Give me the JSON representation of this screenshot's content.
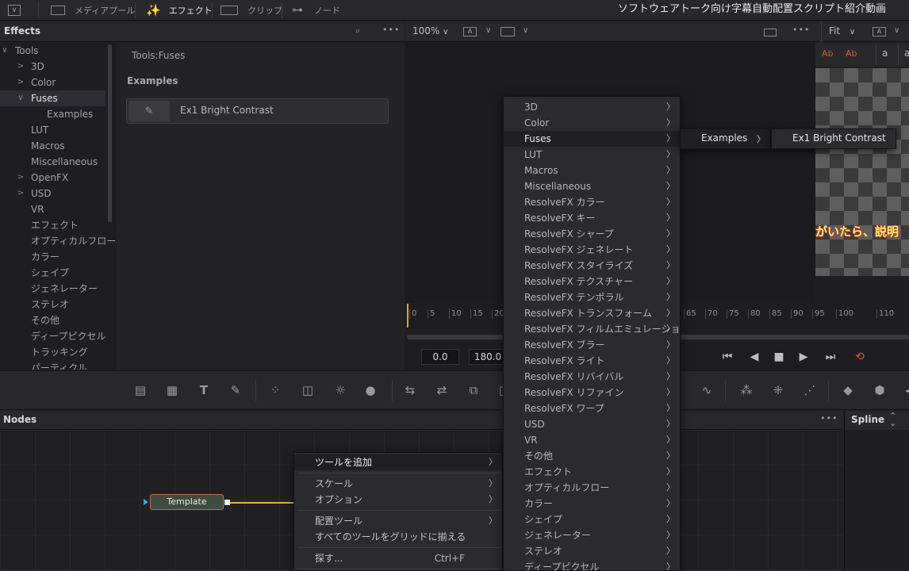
{
  "topbar": {
    "media_pool": "メディアプール",
    "effects": "エフェクト",
    "clips": "クリップ",
    "nodes": "ノード",
    "app_title": "ソフトウェアトーク向け字幕自動配置スクリプト紹介動画"
  },
  "effects_panel": {
    "title": "Effects",
    "breadcrumb": "Tools:Fuses",
    "section_heading": "Examples",
    "item_label": "Ex1 Bright Contrast",
    "tree": [
      {
        "label": "Tools",
        "chev": "∨"
      },
      {
        "label": "3D",
        "chev": ">"
      },
      {
        "label": "Color",
        "chev": ">"
      },
      {
        "label": "Fuses",
        "chev": "∨"
      },
      {
        "label": "Examples",
        "chev": ""
      },
      {
        "label": "LUT",
        "chev": ""
      },
      {
        "label": "Macros",
        "chev": ""
      },
      {
        "label": "Miscellaneous",
        "chev": ""
      },
      {
        "label": "OpenFX",
        "chev": ">"
      },
      {
        "label": "USD",
        "chev": ">"
      },
      {
        "label": "VR",
        "chev": ""
      },
      {
        "label": "エフェクト",
        "chev": ""
      },
      {
        "label": "オプティカルフロー",
        "chev": ""
      },
      {
        "label": "カラー",
        "chev": ""
      },
      {
        "label": "シェイプ",
        "chev": ""
      },
      {
        "label": "ジェネレーター",
        "chev": ""
      },
      {
        "label": "ステレオ",
        "chev": ""
      },
      {
        "label": "その他",
        "chev": ""
      },
      {
        "label": "ディープピクセル",
        "chev": ""
      },
      {
        "label": "トラッキング",
        "chev": ""
      },
      {
        "label": "パーティクル",
        "chev": ""
      }
    ]
  },
  "viewer": {
    "zoom": "100%",
    "fit": "Fit",
    "subtitle_snippet": "がいたら、説明",
    "ruler_ticks": [
      "0",
      "5",
      "10",
      "15",
      "20",
      "65",
      "70",
      "75",
      "80",
      "85",
      "90",
      "95",
      "100",
      "110"
    ],
    "time_start": "0.0",
    "time_end": "180.0"
  },
  "nodes_panel": {
    "title": "Nodes",
    "spline_title": "Spline",
    "node_label": "Template"
  },
  "context_menu": {
    "add_tool": "ツールを追加",
    "scale": "スケール",
    "options": "オプション",
    "arrange_tools": "配置ツール",
    "align_all_to_grid": "すべてのツールをグリッドに揃える",
    "find": "探す...",
    "find_shortcut": "Ctrl+F"
  },
  "category_menu": [
    "3D",
    "Color",
    "Fuses",
    "LUT",
    "Macros",
    "Miscellaneous",
    "ResolveFX カラー",
    "ResolveFX キー",
    "ResolveFX シャープ",
    "ResolveFX ジェネレート",
    "ResolveFX スタイライズ",
    "ResolveFX テクスチャー",
    "ResolveFX テンポラル",
    "ResolveFX トランスフォーム",
    "ResolveFX フィルムエミュレーション",
    "ResolveFX ブラー",
    "ResolveFX ライト",
    "ResolveFX リバイバル",
    "ResolveFX リファイン",
    "ResolveFX ワープ",
    "USD",
    "VR",
    "その他",
    "エフェクト",
    "オプティカルフロー",
    "カラー",
    "シェイプ",
    "ジェネレーター",
    "ステレオ",
    "ディープピクセル"
  ],
  "submenu": {
    "examples": "Examples",
    "fuse_item": "Ex1 Bright Contrast"
  },
  "colors": {
    "accent_orange": "#e6a23c",
    "node_border": "#c7684a",
    "link_yellow": "#e6b82c"
  }
}
